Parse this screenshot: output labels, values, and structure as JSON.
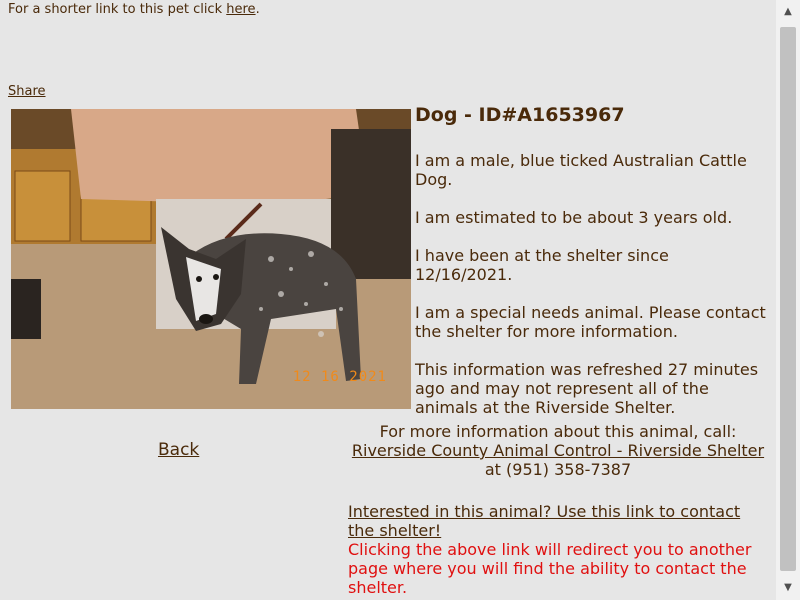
{
  "header": {
    "shortlink_text": "For a shorter link to this pet click",
    "shortlink_link": "here",
    "shortlink_end": ".",
    "share_label": "Share"
  },
  "pet": {
    "title": "Dog - ID#A1653967",
    "description": "I am a male, blue ticked Australian Cattle Dog.",
    "age": "I am estimated to be about 3 years old.",
    "since": "I have been at the shelter since 12/16/2021.",
    "special_needs": "I am a special needs animal. Please contact the shelter for more information.",
    "refresh": "This information was refreshed 27 minutes ago and may not represent all of the animals at the Riverside Shelter.",
    "photo_date_stamp": "12 16 2021"
  },
  "nav": {
    "back_label": "Back"
  },
  "contact": {
    "intro": "For more information about this animal, call:",
    "shelter_link": "Riverside County Animal Control - Riverside Shelter",
    "phone_prefix": " at ",
    "phone": "(951) 358-7387",
    "interested_link": "Interested in this animal? Use this link to contact the shelter!",
    "redirect_warning": "Clicking the above link will redirect you to another page where you will find the ability to contact the shelter."
  },
  "scrollbar": {
    "up_icon": "arrow-up-icon",
    "down_icon": "arrow-down-icon"
  },
  "colors": {
    "text": "#4a2a0a",
    "background": "#e6e6e6",
    "warning": "#e01010",
    "date_stamp": "#f08a1a"
  }
}
